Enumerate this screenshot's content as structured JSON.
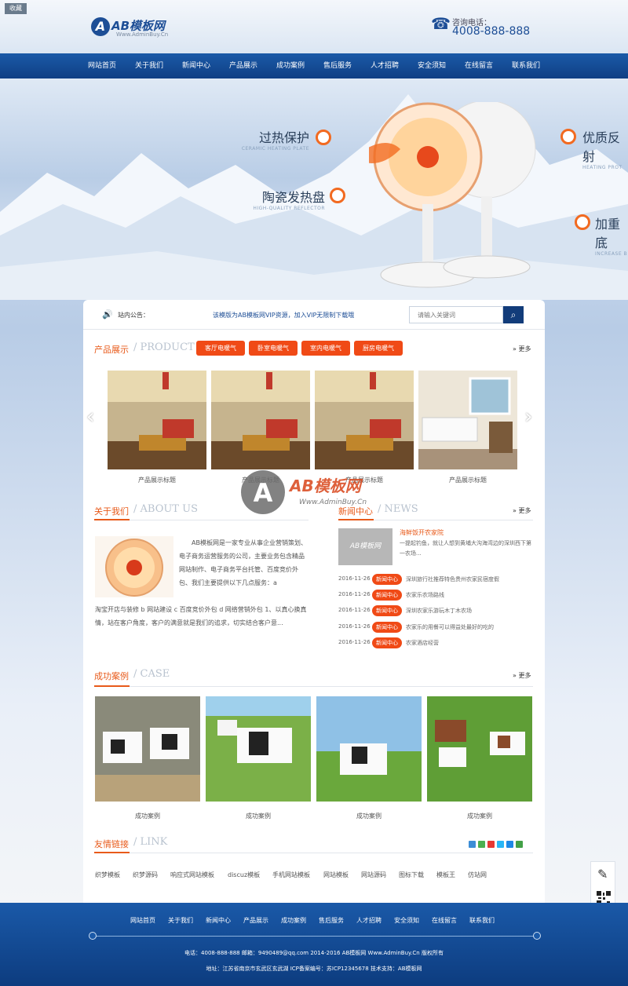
{
  "header": {
    "collect_label": "收藏",
    "logo_badge": "A",
    "logo_text": "AB模板网",
    "logo_sub": "Www.AdminBuy.Cn",
    "phone_label": "咨询电话：",
    "phone_number": "4008-888-888"
  },
  "nav": {
    "items": [
      "网站首页",
      "关于我们",
      "新闻中心",
      "产品展示",
      "成功案例",
      "售后服务",
      "人才招聘",
      "安全须知",
      "在线留言",
      "联系我们"
    ]
  },
  "banner": {
    "features": [
      {
        "title": "过热保护",
        "sub": "CERAMIC HEATING PLATE"
      },
      {
        "title": "陶瓷发热盘",
        "sub": "HIGH-QUALITY REFLECTOR"
      },
      {
        "title": "优质反射",
        "sub": "HEATING PROT"
      },
      {
        "title": "加重底",
        "sub": "INCREASE B"
      }
    ]
  },
  "notice": {
    "label": "站内公告：",
    "text": "该模版为AB模板网VIP资源，加入VIP无限制下载哦",
    "search_placeholder": "请输入关键词"
  },
  "products": {
    "title": "产品展示",
    "title_en": "/ PRODUCT",
    "tabs": [
      "客厅电暖气",
      "卧室电暖气",
      "室内电暖气",
      "厨房电暖气"
    ],
    "more": "更多",
    "captions": [
      "产品展示标题",
      "产品展示标题",
      "产品展示标题",
      "产品展示标题"
    ]
  },
  "about": {
    "title": "关于我们",
    "title_en": "/ ABOUT US",
    "text1": "AB模板网是一家专业从事企业营销策划、电子商务运营服务的公司，主要业务包含精品网站制作、电子商务平台托管、百度竞价外包、我们主要提供以下几点服务：a",
    "text2": "淘宝开店与装修 b 网站建设 c 百度竞价外包 d 网络营销外包 1、以真心换真情，站在客户角度，客户的满意就是我们的追求，切实结合客户意..."
  },
  "news": {
    "title": "新闻中心",
    "title_en": "/ NEWS",
    "more": "更多",
    "thumb_text": "AB模板网",
    "headline": "海鲜饭开农家院",
    "summary": "一提起钓鱼，就让人想到黄埔大沟海湾边的深圳西下第一农场...",
    "badge": "新闻中心",
    "items": [
      {
        "date": "2016-11-26",
        "title": "深圳旅行社推荐特色贵州农家民宿度假"
      },
      {
        "date": "2016-11-26",
        "title": "农家乐农场路线"
      },
      {
        "date": "2016-11-26",
        "title": "深圳农家乐游玩木丁木农场"
      },
      {
        "date": "2016-11-26",
        "title": "农家乐的用餐可以得益处最好的吃的"
      },
      {
        "date": "2016-11-26",
        "title": "农家酒店经营"
      }
    ]
  },
  "cases": {
    "title": "成功案例",
    "title_en": "/ CASE",
    "more": "更多",
    "captions": [
      "成功案例",
      "成功案例",
      "成功案例",
      "成功案例"
    ]
  },
  "links": {
    "title": "友情链接",
    "title_en": "/ LINK",
    "items": [
      "织梦模板",
      "织梦源码",
      "响应式网站模板",
      "discuz模板",
      "手机网站模板",
      "网站模板",
      "网站源码",
      "图标下载",
      "模板王",
      "仿站网"
    ]
  },
  "watermark": {
    "logo": "AB模板网",
    "url": "Www.AdminBuy.Cn"
  },
  "footer": {
    "nav": [
      "网站首页",
      "关于我们",
      "新闻中心",
      "产品展示",
      "成功案例",
      "售后服务",
      "人才招聘",
      "安全须知",
      "在线留言",
      "联系我们"
    ],
    "contact": "电话：4008-888-888   邮箱：9490489@qq.com   2014-2016 AB模板网 Www.AdminBuy.Cn 版权所有",
    "address": "地址：江苏省南京市玄武区玄武湖   ICP备案编号：苏ICP12345678   技术支持：AB模板网"
  }
}
